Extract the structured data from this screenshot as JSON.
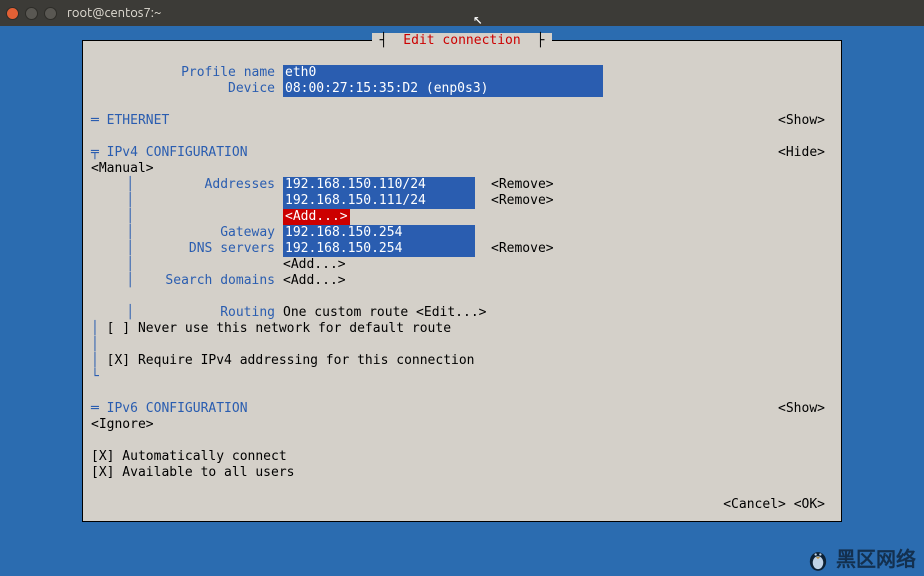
{
  "window": {
    "title": "root@centos7:~"
  },
  "dialog": {
    "title_pipes": "┤ ",
    "title": "Edit connection",
    "title_pipes_end": " ├"
  },
  "profile": {
    "name_label": "Profile name",
    "name_value": "eth0",
    "device_label": "Device",
    "device_value": "08:00:27:15:35:D2 (enp0s3)"
  },
  "ethernet": {
    "header": "═ ETHERNET",
    "show": "<Show>"
  },
  "ipv4": {
    "header_sym": "╤",
    "header": " IPv4 CONFIGURATION",
    "mode": "<Manual>",
    "hide": "<Hide>",
    "addresses_label": "Addresses",
    "addresses": [
      "192.168.150.110/24",
      "192.168.150.111/24"
    ],
    "remove": "<Remove>",
    "add": "<Add...>",
    "add_plain": "<Add...>",
    "gateway_label": "Gateway",
    "gateway_value": "192.168.150.254",
    "dns_label": "DNS servers",
    "dns_value": "192.168.150.254",
    "search_label": "Search domains",
    "routing_label": "Routing",
    "routing_text": "One custom route <Edit...>",
    "never_default": "[ ] Never use this network for default route",
    "require": "[X] Require IPv4 addressing for this connection",
    "tree_end": "└"
  },
  "ipv6": {
    "header": "═ IPv6 CONFIGURATION",
    "mode": "<Ignore>",
    "show": "<Show>"
  },
  "auto_connect": "[X] Automatically connect",
  "all_users": "[X] Available to all users",
  "footer": {
    "cancel": "<Cancel>",
    "ok": "<OK>"
  },
  "watermark": "黑区网络"
}
